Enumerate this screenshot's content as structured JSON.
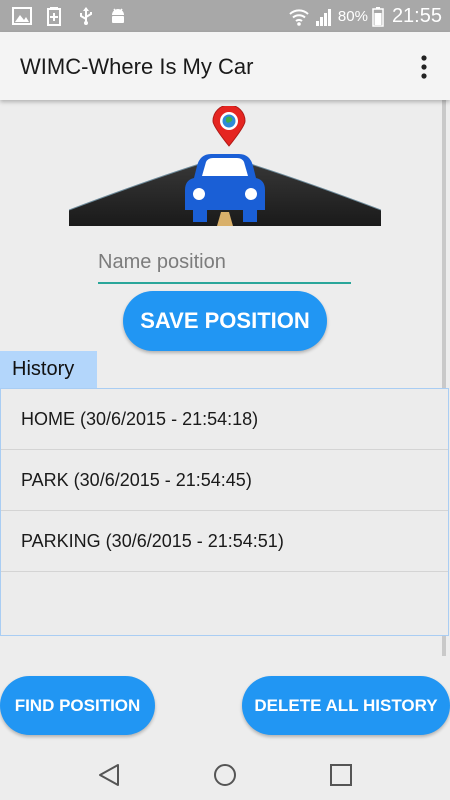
{
  "status_bar": {
    "battery_percent": "80%",
    "time": "21:55",
    "left_icons": [
      "image-icon",
      "battery-saver-icon",
      "usb-icon",
      "android-icon"
    ],
    "right_icons": [
      "wifi-icon",
      "signal-icon",
      "battery-icon"
    ]
  },
  "app_bar": {
    "title": "WIMC-Where Is My Car",
    "overflow_icon": "more-vertical-icon"
  },
  "main": {
    "name_input": {
      "value": "",
      "placeholder": "Name position"
    },
    "save_button": "SAVE POSITION",
    "history_label": "History",
    "history": [
      "HOME (30/6/2015 - 21:54:18)",
      "PARK (30/6/2015 - 21:54:45)",
      "PARKING (30/6/2015 - 21:54:51)"
    ]
  },
  "bottom_buttons": {
    "find": "FIND POSITION",
    "delete_all": "DELETE ALL HISTORY"
  },
  "colors": {
    "accent": "#2196f3",
    "status_bar": "#a8a8a8",
    "history_tab": "#b3d6fb",
    "input_underline": "#2aa69a",
    "pin": "#e52521",
    "car": "#1a5fd6"
  }
}
